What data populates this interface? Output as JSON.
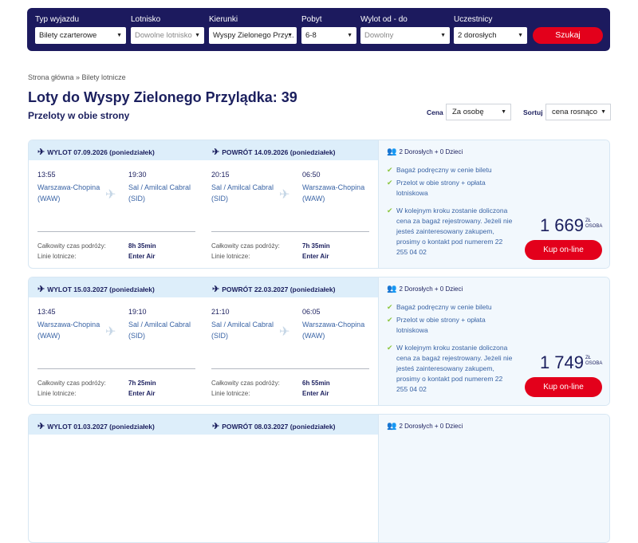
{
  "search": {
    "fields": [
      {
        "label": "Typ wyjazdu",
        "value": "Bilety czarterowe"
      },
      {
        "label": "Lotnisko",
        "value": "Dowolne lotnisko"
      },
      {
        "label": "Kierunki",
        "value": "Wyspy Zielonego Przy..."
      },
      {
        "label": "Pobyt",
        "value": "6-8"
      },
      {
        "label": "Wylot od - do",
        "value": "Dowolny"
      },
      {
        "label": "Uczestnicy",
        "value": "2 dorosłych"
      }
    ],
    "button": "Szukaj"
  },
  "breadcrumb": "Strona główna » Bilety lotnicze",
  "title": "Loty do Wyspy Zielonego Przylądka: 39",
  "subtitle": "Przeloty w obie strony",
  "sort": {
    "price_label": "Cena",
    "price_value": "Za osobę",
    "order_label": "Sortuj",
    "order_value": "cena rosnąco"
  },
  "cards": [
    {
      "outbound": {
        "header": "WYLOT 07.09.2026 (poniedziałek)",
        "dep_time": "13:55",
        "dep_place": "Warszawa-Chopina",
        "dep_code": "(WAW)",
        "arr_time": "19:30",
        "arr_place": "Sal / Amilcal Cabral",
        "arr_code": "(SID)",
        "duration_label": "Całkowity czas podróży:",
        "duration": "8h 35min",
        "airline_label": "Linie lotnicze:",
        "airline": "Enter Air"
      },
      "return": {
        "header": "POWRÓT 14.09.2026 (poniedziałek)",
        "dep_time": "20:15",
        "dep_place": "Sal / Amilcal Cabral",
        "dep_code": "(SID)",
        "arr_time": "06:50",
        "arr_place": "Warszawa-Chopina",
        "arr_code": "(WAW)",
        "duration_label": "Całkowity czas podróży:",
        "duration": "7h 35min",
        "airline_label": "Linie lotnicze:",
        "airline": "Enter Air"
      },
      "pax": "2 Dorosłych + 0 Dzieci",
      "features": [
        "Bagaż podręczny w cenie biletu",
        "Przelot w obie strony + opłata lotniskowa",
        "W kolejnym kroku zostanie doliczona cena za bagaż rejestrowany. Jeżeli nie jesteś zainteresowany zakupem, prosimy o kontakt pod numerem 22 255 04 02"
      ],
      "price": "1 669",
      "currency": "ZŁ",
      "per": "OSOBA",
      "buy": "Kup on-line"
    },
    {
      "outbound": {
        "header": "WYLOT 15.03.2027 (poniedziałek)",
        "dep_time": "13:45",
        "dep_place": "Warszawa-Chopina",
        "dep_code": "(WAW)",
        "arr_time": "19:10",
        "arr_place": "Sal / Amilcal Cabral",
        "arr_code": "(SID)",
        "duration_label": "Całkowity czas podróży:",
        "duration": "7h 25min",
        "airline_label": "Linie lotnicze:",
        "airline": "Enter Air"
      },
      "return": {
        "header": "POWRÓT 22.03.2027 (poniedziałek)",
        "dep_time": "21:10",
        "dep_place": "Sal / Amilcal Cabral",
        "dep_code": "(SID)",
        "arr_time": "06:05",
        "arr_place": "Warszawa-Chopina",
        "arr_code": "(WAW)",
        "duration_label": "Całkowity czas podróży:",
        "duration": "6h 55min",
        "airline_label": "Linie lotnicze:",
        "airline": "Enter Air"
      },
      "pax": "2 Dorosłych + 0 Dzieci",
      "features": [
        "Bagaż podręczny w cenie biletu",
        "Przelot w obie strony + opłata lotniskowa",
        "W kolejnym kroku zostanie doliczona cena za bagaż rejestrowany. Jeżeli nie jesteś zainteresowany zakupem, prosimy o kontakt pod numerem 22 255 04 02"
      ],
      "price": "1 749",
      "currency": "ZŁ",
      "per": "OSOBA",
      "buy": "Kup on-line"
    },
    {
      "outbound": {
        "header": "WYLOT 01.03.2027 (poniedziałek)"
      },
      "return": {
        "header": "POWRÓT 08.03.2027 (poniedziałek)"
      },
      "pax": "2 Dorosłych + 0 Dzieci"
    }
  ]
}
